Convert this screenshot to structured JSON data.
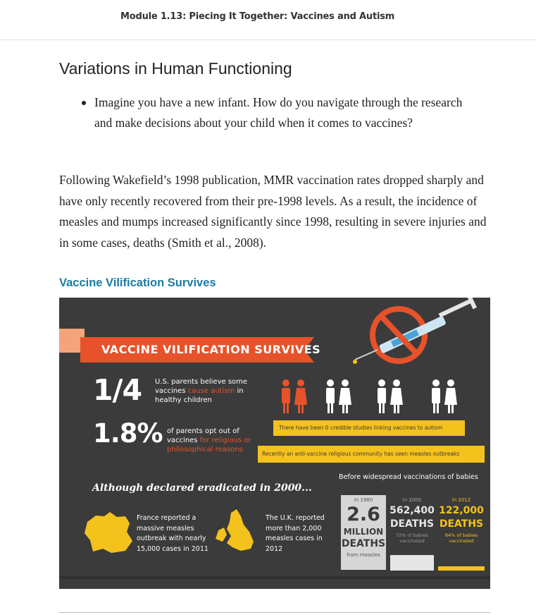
{
  "header": {
    "module_title": "Module 1.13: Piecing It Together: Vaccines and Autism"
  },
  "section": {
    "title": "Variations in Human Functioning"
  },
  "bullets": [
    "Imagine you have a new infant. How do you navigate through the research and make decisions about your child when it comes to vaccines?"
  ],
  "paragraph": "Following Wakefield’s 1998 publication, MMR vaccination rates dropped sharply and have only recently recovered from their pre-1998 levels. As a result, the incidence of measles and mumps increased significantly since 1998, resulting in severe injuries and in some cases, deaths (Smith et al., 2008).",
  "figure": {
    "heading": "Vaccine Vilification Survives",
    "banner": "VACCINE VILIFICATION SURVIVES",
    "stat1": {
      "value": "1/4",
      "text_a": "U.S. parents believe some",
      "text_b": "vaccines ",
      "highlight": "cause autism",
      "text_c": " in",
      "text_d": "healthy children"
    },
    "stat2": {
      "value": "1.8%",
      "text_a": "of parents opt out of",
      "text_b": "vaccines ",
      "highlight_a": "for religious or",
      "highlight_b": "philosophical reasons"
    },
    "callout1": "There have been 0 credible studies linking vaccines to autism",
    "callout2": "Recently an anti-vaccine religious community has seen measles outbreaks",
    "eradicated": "Although declared eradicated in 2000...",
    "france": {
      "lines": [
        "France reported a",
        "massive measles",
        "outbreak with nearly",
        "15,000 cases in 2011"
      ]
    },
    "uk": {
      "lines": [
        "The U.K. reported",
        "more than 2,000",
        "measles cases in",
        "2012"
      ]
    },
    "before_label": "Before widespread vaccinations of babies",
    "col1980": {
      "year": "in 1980",
      "big": "2.6",
      "unit1": "MILLION",
      "unit2": "DEATHS",
      "sub": "from measles"
    },
    "col2000": {
      "year": "in 2000",
      "value": "562,400",
      "unit": "DEATHS",
      "sub1": "72% of babies",
      "sub2": "vaccinated"
    },
    "col2012": {
      "year": "in 2012",
      "value": "122,000",
      "unit": "DEATHS",
      "sub1": "84% of babies",
      "sub2": "vaccinated"
    },
    "colors": {
      "bg": "#3b3b3b",
      "orange": "#e8522a",
      "yellow": "#f4c21c",
      "white": "#ffffff",
      "gray": "#cfcfcf"
    },
    "people_icons": [
      "person-icon-orange",
      "person-icon-white",
      "person-icon-white",
      "person-icon-white"
    ]
  }
}
